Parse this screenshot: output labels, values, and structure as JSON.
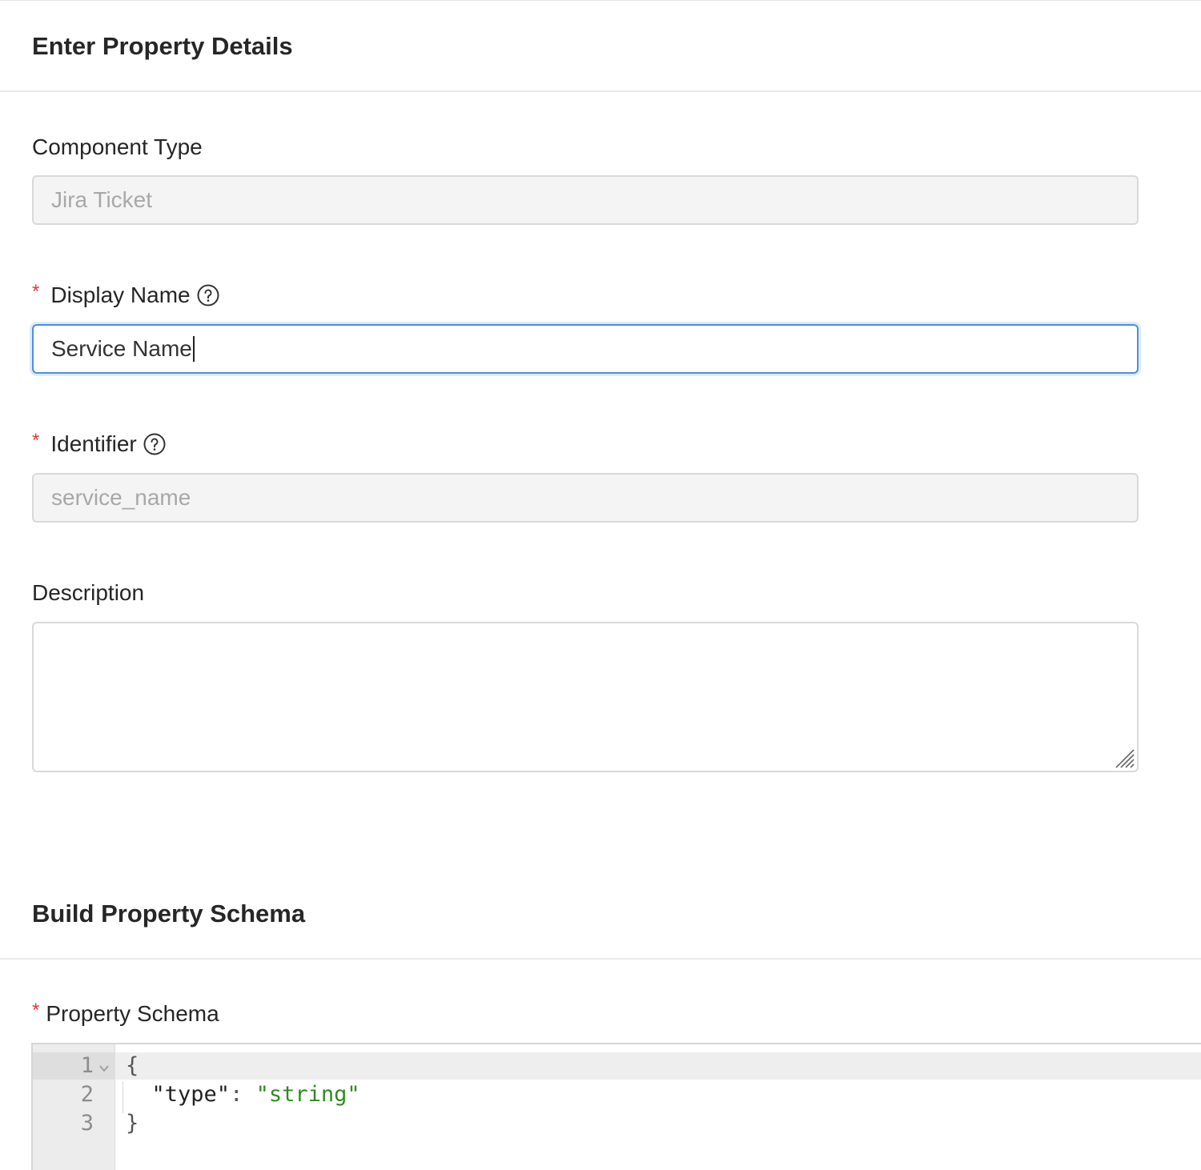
{
  "section1": {
    "title": "Enter Property Details"
  },
  "component_type": {
    "label": "Component Type",
    "value": "Jira Ticket"
  },
  "display_name": {
    "required_mark": "*",
    "label": "Display Name",
    "value": "Service Name"
  },
  "identifier": {
    "required_mark": "*",
    "label": "Identifier",
    "value": "service_name"
  },
  "description": {
    "label": "Description",
    "value": ""
  },
  "section2": {
    "title": "Build Property Schema"
  },
  "property_schema": {
    "required_mark": "*",
    "label": "Property Schema",
    "line_numbers": [
      "1",
      "2",
      "3"
    ],
    "lines": {
      "open_brace": "{",
      "key": "\"type\"",
      "colon": ": ",
      "value": "\"string\"",
      "close_brace": "}"
    }
  },
  "colors": {
    "accent": "#4a90e2",
    "required": "#e53935",
    "string": "#2e8b1e"
  },
  "icons": {
    "help": "question-circle-icon",
    "fold": "chevron-down-icon",
    "resize": "resize-handle-icon"
  }
}
